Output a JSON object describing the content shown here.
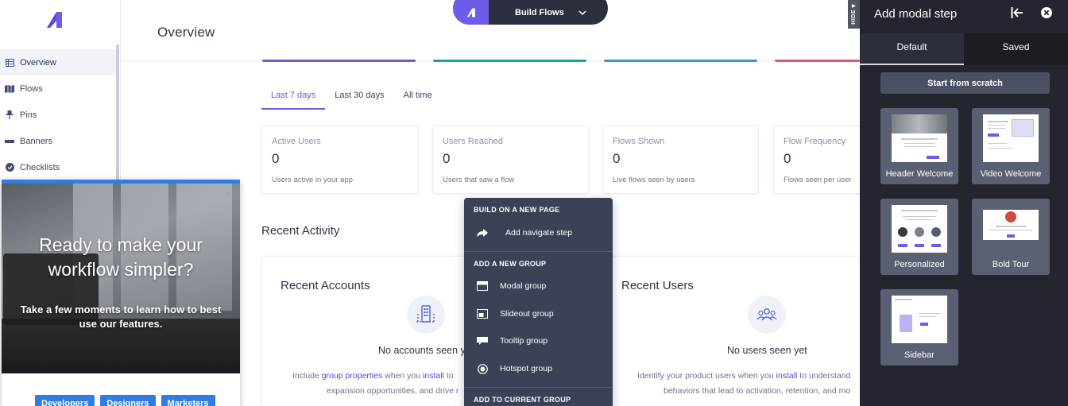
{
  "app": {
    "page_title": "Overview",
    "build_flows_label": "Build Flows",
    "hide_label": "HIDE"
  },
  "sidebar": {
    "items": [
      {
        "label": "Overview",
        "icon": "table-icon"
      },
      {
        "label": "Flows",
        "icon": "map-icon"
      },
      {
        "label": "Pins",
        "icon": "pin-icon"
      },
      {
        "label": "Banners",
        "icon": "banner-icon"
      },
      {
        "label": "Checklists",
        "icon": "check-circle-icon"
      }
    ]
  },
  "tabs": [
    "Last 7 days",
    "Last 30 days",
    "All time"
  ],
  "stats": [
    {
      "title": "Active Users",
      "value": "0",
      "desc": "Users active in your app"
    },
    {
      "title": "Users Reached",
      "value": "0",
      "desc": "Users that saw a flow"
    },
    {
      "title": "Flows Shown",
      "value": "0",
      "desc": "Live flows seen by users"
    },
    {
      "title": "Flow Frequency",
      "value": "0",
      "desc": "Flows seen per user"
    }
  ],
  "recent_activity": "Recent Activity",
  "recent_accounts": {
    "title": "Recent Accounts",
    "empty": "No accounts seen y",
    "desc_1a": "Include ",
    "desc_link1": "group properties",
    "desc_1b": " when you ",
    "desc_link2": "install",
    "desc_1c": " to",
    "desc_2": "expansion opportunities, and drive r"
  },
  "recent_users": {
    "title": "Recent Users",
    "empty": "No users seen yet",
    "desc_1a": "Identify your product users when you ",
    "desc_link": "install",
    "desc_1b": " to understand",
    "desc_2": "behaviors that lead to activation, retention, and mo"
  },
  "menu": {
    "sec1": "BUILD ON A NEW PAGE",
    "navigate": "Add navigate step",
    "sec2": "ADD A NEW GROUP",
    "modal": "Modal group",
    "slideout": "Slideout group",
    "tooltip": "Tooltip group",
    "hotspot": "Hotspot group",
    "sec3": "ADD TO CURRENT GROUP"
  },
  "promo": {
    "headline_1": "Ready to make your",
    "headline_2": "workflow simpler?",
    "sub_1": "Take a few moments to learn how to best",
    "sub_2": "use our features.",
    "buttons": [
      "Developers",
      "Designers",
      "Marketers"
    ],
    "close": "✕"
  },
  "drawer": {
    "title": "Add modal step",
    "tab_default": "Default",
    "tab_saved": "Saved",
    "scratch": "Start from scratch",
    "tiles": [
      "Header Welcome",
      "Video Welcome",
      "Personalized",
      "Bold Tour",
      "Sidebar"
    ]
  },
  "colors": {
    "accent": "#5b5fe0",
    "brand_purple": "#6c5ce7",
    "drawer_bg": "#23262e",
    "menu_bg": "#3b4256",
    "promo_blue": "#2f7de1"
  }
}
